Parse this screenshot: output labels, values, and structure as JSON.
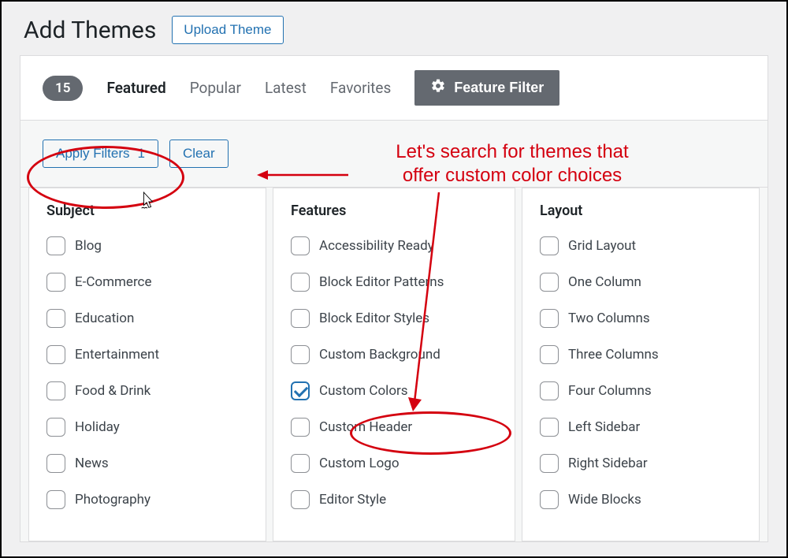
{
  "header": {
    "title": "Add Themes",
    "upload_label": "Upload Theme"
  },
  "tabs": {
    "count": "15",
    "items": [
      "Featured",
      "Popular",
      "Latest",
      "Favorites"
    ],
    "feature_filter_label": "Feature Filter"
  },
  "filter_actions": {
    "apply_label": "Apply Filters",
    "apply_count": "1",
    "clear_label": "Clear"
  },
  "columns": [
    {
      "heading": "Subject",
      "items": [
        {
          "label": "Blog",
          "checked": false
        },
        {
          "label": "E-Commerce",
          "checked": false
        },
        {
          "label": "Education",
          "checked": false
        },
        {
          "label": "Entertainment",
          "checked": false
        },
        {
          "label": "Food & Drink",
          "checked": false
        },
        {
          "label": "Holiday",
          "checked": false
        },
        {
          "label": "News",
          "checked": false
        },
        {
          "label": "Photography",
          "checked": false
        }
      ]
    },
    {
      "heading": "Features",
      "items": [
        {
          "label": "Accessibility Ready",
          "checked": false
        },
        {
          "label": "Block Editor Patterns",
          "checked": false
        },
        {
          "label": "Block Editor Styles",
          "checked": false
        },
        {
          "label": "Custom Background",
          "checked": false
        },
        {
          "label": "Custom Colors",
          "checked": true
        },
        {
          "label": "Custom Header",
          "checked": false
        },
        {
          "label": "Custom Logo",
          "checked": false
        },
        {
          "label": "Editor Style",
          "checked": false
        }
      ]
    },
    {
      "heading": "Layout",
      "items": [
        {
          "label": "Grid Layout",
          "checked": false
        },
        {
          "label": "One Column",
          "checked": false
        },
        {
          "label": "Two Columns",
          "checked": false
        },
        {
          "label": "Three Columns",
          "checked": false
        },
        {
          "label": "Four Columns",
          "checked": false
        },
        {
          "label": "Left Sidebar",
          "checked": false
        },
        {
          "label": "Right Sidebar",
          "checked": false
        },
        {
          "label": "Wide Blocks",
          "checked": false
        }
      ]
    }
  ],
  "annotation": {
    "text_line1": "Let's search for themes that",
    "text_line2": "offer custom color choices"
  }
}
